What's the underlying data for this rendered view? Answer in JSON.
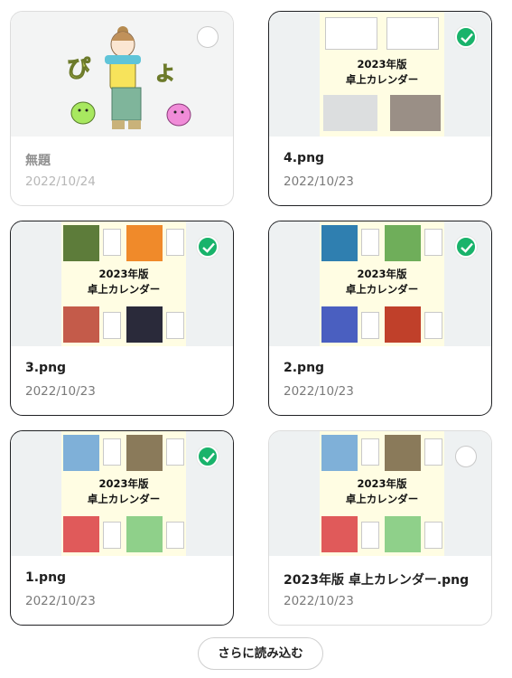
{
  "cards": [
    {
      "title": "無題",
      "date": "2022/10/24",
      "selected": false
    },
    {
      "title": "4.png",
      "date": "2022/10/23",
      "selected": true
    },
    {
      "title": "3.png",
      "date": "2022/10/23",
      "selected": true
    },
    {
      "title": "2.png",
      "date": "2022/10/23",
      "selected": true
    },
    {
      "title": "1.png",
      "date": "2022/10/23",
      "selected": true
    },
    {
      "title": "2023年版 卓上カレンダー.png",
      "date": "2022/10/23",
      "selected": false
    }
  ],
  "calendar_heading": {
    "line1": "2023年版",
    "line2": "卓上カレンダー"
  },
  "drawing_text": {
    "left": "ぴ",
    "right": "よ"
  },
  "load_more_label": "さらに読み込む",
  "colors": {
    "check": "#19b36b",
    "selected_border": "#202124"
  }
}
